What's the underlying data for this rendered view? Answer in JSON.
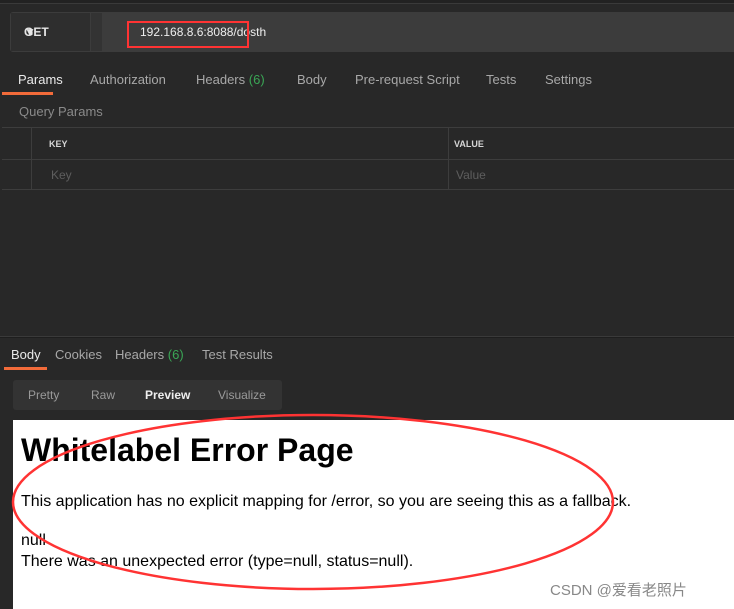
{
  "request": {
    "method": "GET",
    "url": "192.168.8.6:8088/dosth"
  },
  "request_tabs": [
    {
      "label": "Params",
      "active": true
    },
    {
      "label": "Authorization"
    },
    {
      "label": "Headers",
      "count": "(6)"
    },
    {
      "label": "Body"
    },
    {
      "label": "Pre-request Script"
    },
    {
      "label": "Tests"
    },
    {
      "label": "Settings"
    }
  ],
  "query_params": {
    "title": "Query Params",
    "key_header": "KEY",
    "value_header": "VALUE",
    "key_placeholder": "Key",
    "value_placeholder": "Value"
  },
  "response_tabs": [
    {
      "label": "Body",
      "active": true
    },
    {
      "label": "Cookies"
    },
    {
      "label": "Headers",
      "count": "(6)"
    },
    {
      "label": "Test Results"
    }
  ],
  "view_modes": [
    {
      "label": "Pretty"
    },
    {
      "label": "Raw"
    },
    {
      "label": "Preview",
      "active": true
    },
    {
      "label": "Visualize"
    }
  ],
  "preview": {
    "title": "Whitelabel Error Page",
    "message": "This application has no explicit mapping for /error, so you are seeing this as a fallback.",
    "line1": "null",
    "line2": "There was an unexpected error (type=null, status=null)."
  },
  "watermark": "CSDN @爱看老照片",
  "colors": {
    "accent": "#f26b3a",
    "count_green": "#3aa655",
    "annotation_red": "#ff3333"
  }
}
